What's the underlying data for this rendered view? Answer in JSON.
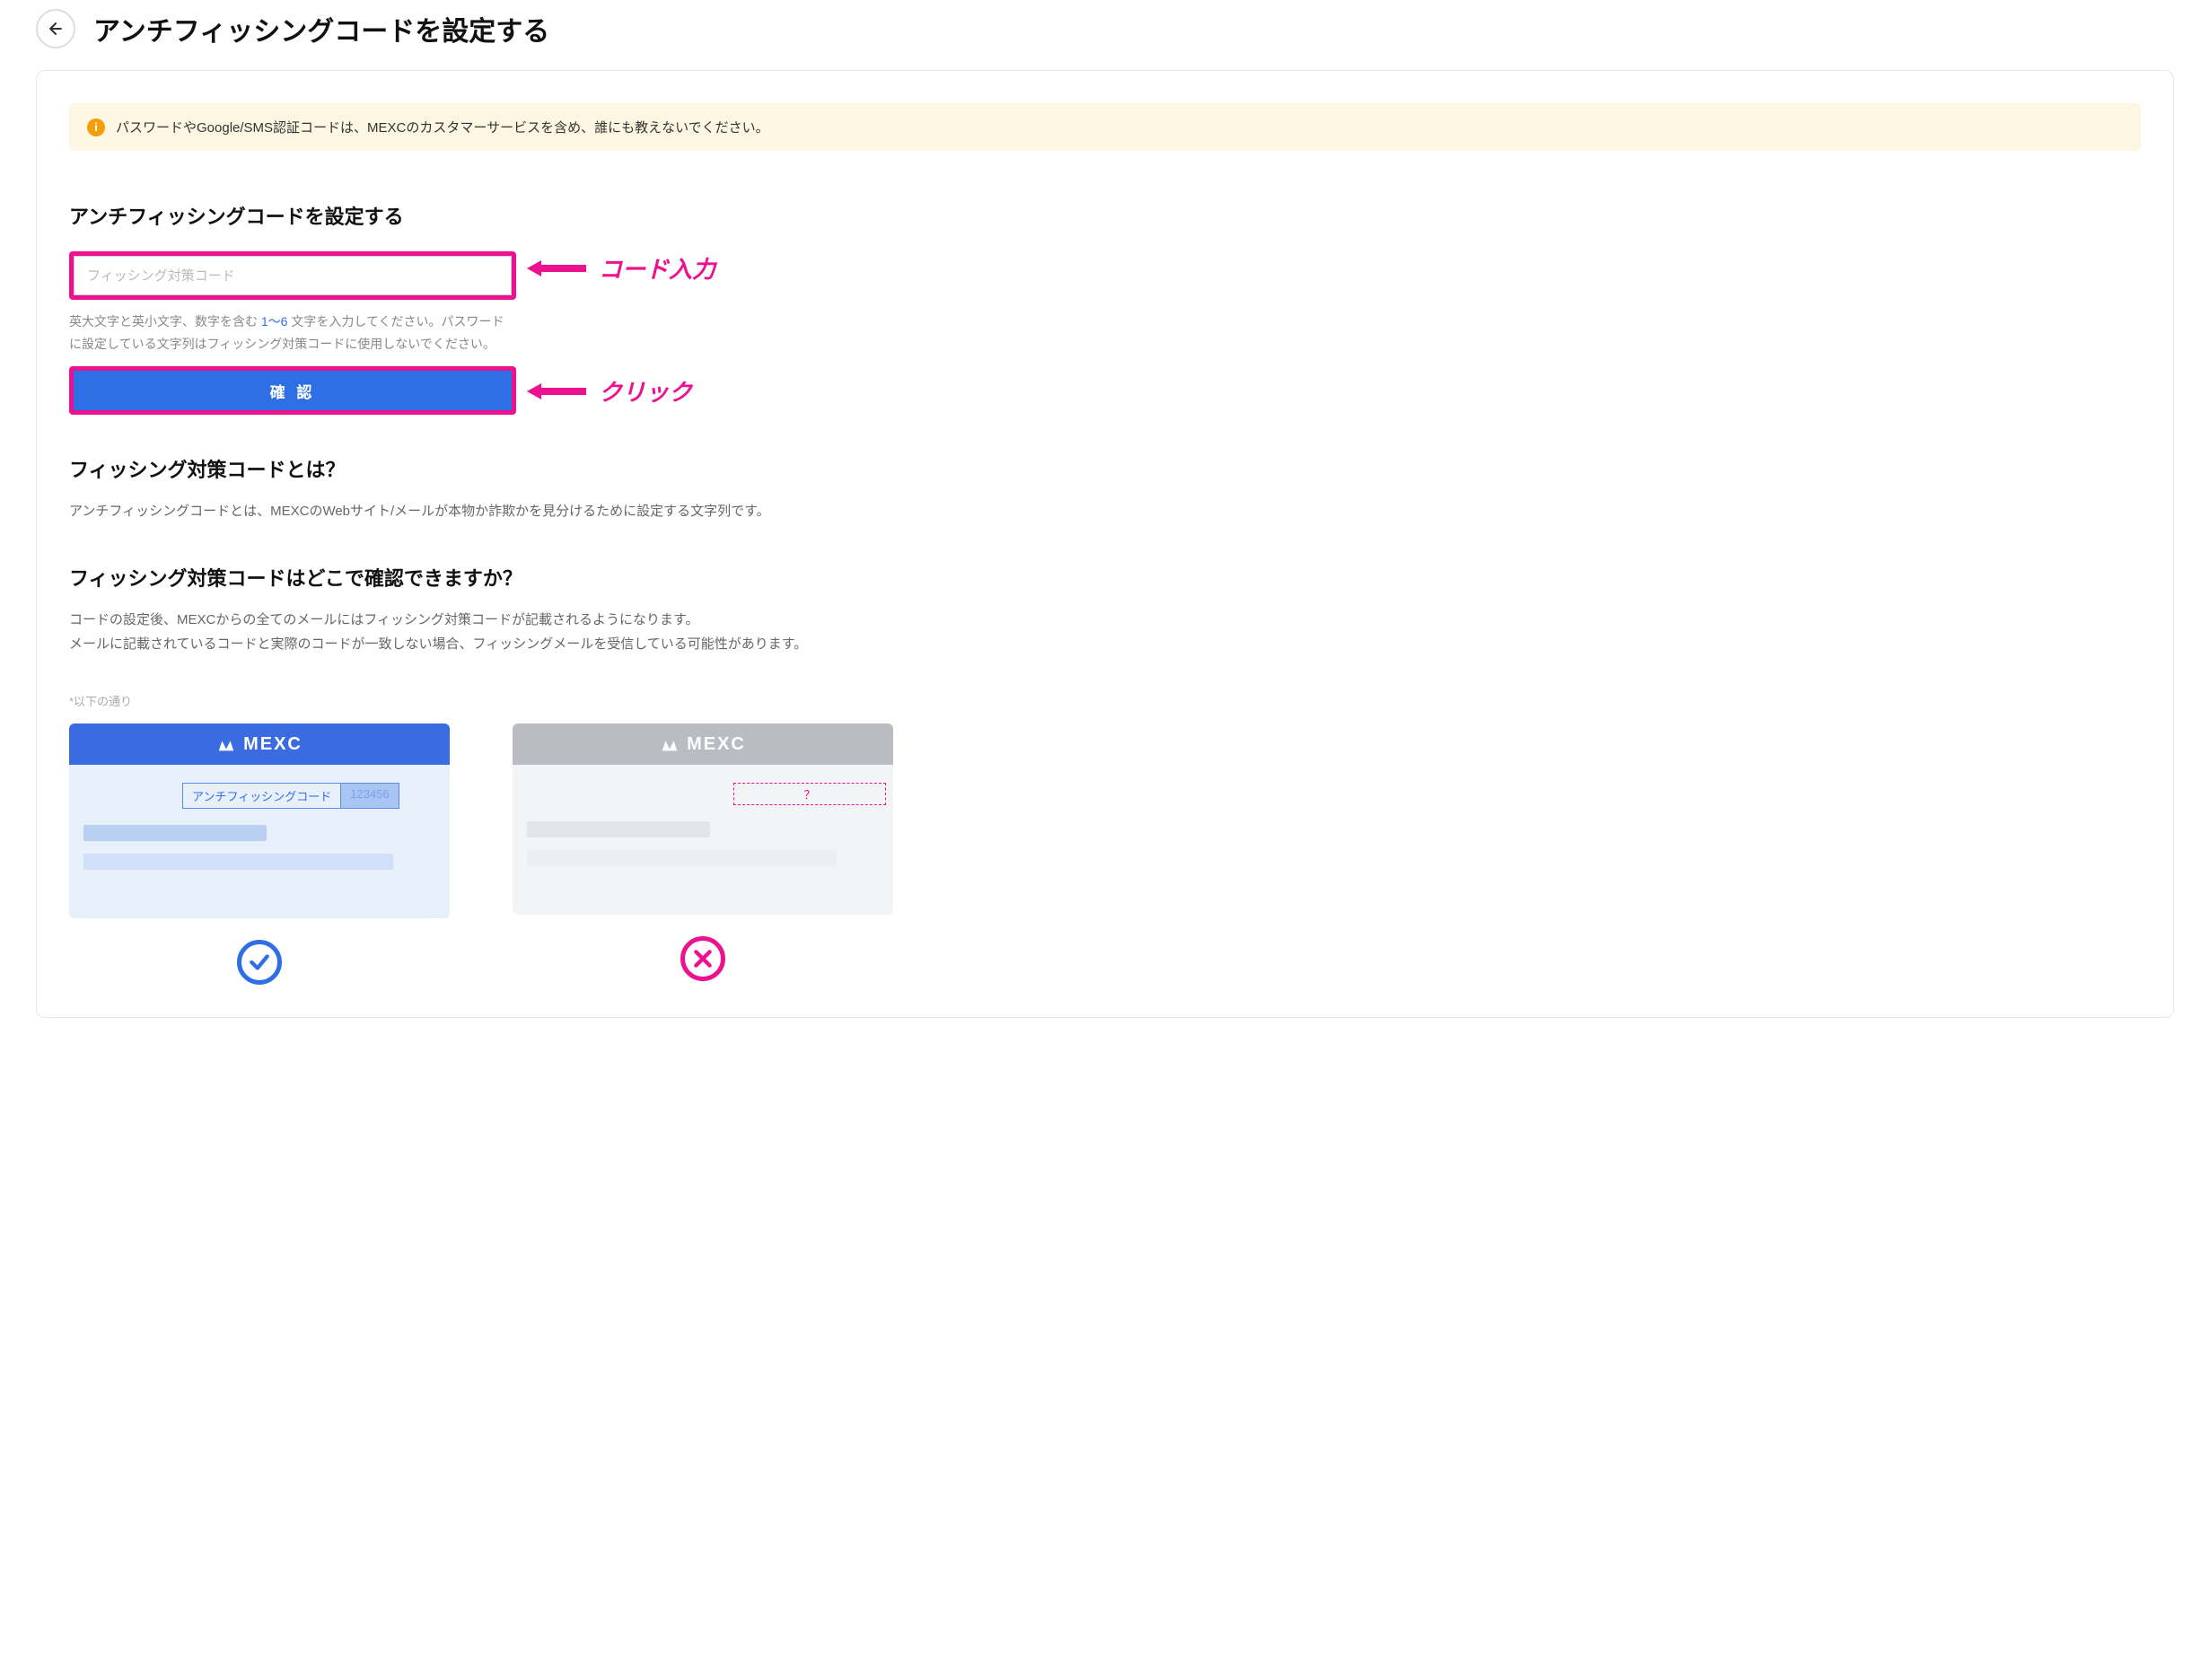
{
  "header": {
    "title": "アンチフィッシングコードを設定する"
  },
  "warning": {
    "text": "パスワードやGoogle/SMS認証コードは、MEXCのカスタマーサービスを含め、誰にも教えないでください。"
  },
  "form": {
    "title": "アンチフィッシングコードを設定する",
    "placeholder": "フィッシング対策コード",
    "help_before": "英大文字と英小文字、数字を含む ",
    "help_highlight": "1〜6",
    "help_after": " 文字を入力してください。パスワードに設定している文字列はフィッシング対策コードに使用しないでください。",
    "confirm": "確 認"
  },
  "annotations": {
    "input": "コード入力",
    "click": "クリック"
  },
  "faq1": {
    "q": "フィッシング対策コードとは？",
    "a": "アンチフィッシングコードとは、MEXCのWebサイト/メールが本物か詐欺かを見分けるために設定する文字列です。"
  },
  "faq2": {
    "q": "フィッシング対策コードはどこで確認できますか？",
    "a1": "コードの設定後、MEXCからの全てのメールにはフィッシング対策コードが記載されるようになります。",
    "a2": "メールに記載されているコードと実際のコードが一致しない場合、フィッシングメールを受信している可能性があります。"
  },
  "examples": {
    "note": "*以下の通り",
    "brand": "MEXC",
    "good_label": "アンチフィッシングコード",
    "good_value": "123456",
    "bad_value": "？"
  }
}
